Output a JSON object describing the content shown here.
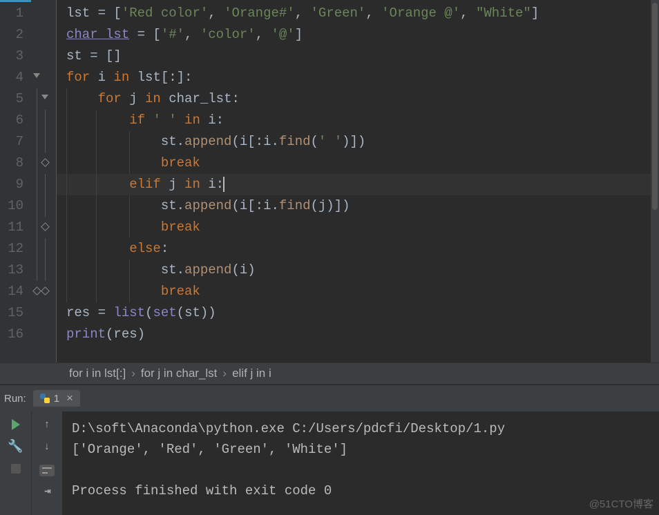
{
  "editor": {
    "line_numbers": [
      "1",
      "2",
      "3",
      "4",
      "5",
      "6",
      "7",
      "8",
      "9",
      "10",
      "11",
      "12",
      "13",
      "14",
      "15",
      "16"
    ],
    "current_line": 9,
    "code": {
      "line1": {
        "var": "lst",
        "eq": " = [",
        "s1": "'Red color'",
        "c1": ", ",
        "s2": "'Orange#'",
        "c2": ", ",
        "s3": "'Green'",
        "c3": ", ",
        "s4": "'Orange @'",
        "c4": ", ",
        "s5": "\"White\"",
        "close": "]"
      },
      "line2": {
        "var": "char_lst",
        "eq": " = [",
        "s1": "'#'",
        "c1": ", ",
        "s2": "'color'",
        "c2": ", ",
        "s3": "'@'",
        "close": "]"
      },
      "line3": {
        "var": "st",
        "eq": " = []"
      },
      "line4": {
        "kw1": "for ",
        "v": "i ",
        "kw2": "in ",
        "expr": "lst[:]:"
      },
      "line5": {
        "kw1": "for ",
        "v": "j ",
        "kw2": "in ",
        "expr": "char_lst:"
      },
      "line6": {
        "kw1": "if ",
        "s": "' '",
        "kw2": " in ",
        "v": "i",
        "colon": ":"
      },
      "line7": {
        "pre": "st.",
        "fn": "append",
        "a": "(i[:i.",
        "fn2": "find",
        "b": "(",
        "s": "' '",
        "c": ")])"
      },
      "line8": {
        "kw": "break"
      },
      "line9": {
        "kw1": "elif ",
        "v1": "j ",
        "kw2": "in ",
        "v2": "i",
        "colon": ":"
      },
      "line10": {
        "pre": "st.",
        "fn": "append",
        "a": "(i[:i.",
        "fn2": "find",
        "b": "(j)])"
      },
      "line11": {
        "kw": "break"
      },
      "line12": {
        "kw": "else",
        "colon": ":"
      },
      "line13": {
        "pre": "st.",
        "fn": "append",
        "a": "(i)"
      },
      "line14": {
        "kw": "break"
      },
      "line15": {
        "v": "res",
        "eq": " = ",
        "fn": "list",
        "a": "(",
        "fn2": "set",
        "b": "(st))"
      },
      "line16": {
        "fn": "print",
        "a": "(res)"
      }
    }
  },
  "breadcrumbs": {
    "c1": "for i in lst[:]",
    "c2": "for j in char_lst",
    "c3": "elif j in i"
  },
  "run": {
    "label": "Run:",
    "tab_name": "1",
    "output_line1": "D:\\soft\\Anaconda\\python.exe C:/Users/pdcfi/Desktop/1.py",
    "output_line2": "['Orange', 'Red', 'Green', 'White']",
    "output_line3": "Process finished with exit code 0"
  },
  "watermark": "@51CTO博客"
}
